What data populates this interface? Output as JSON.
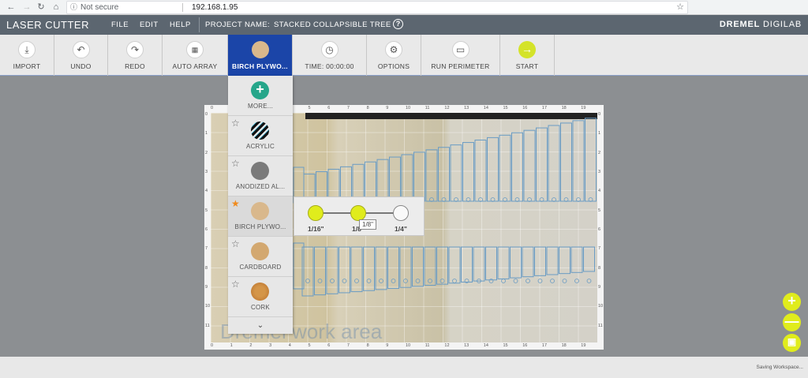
{
  "browser": {
    "back_icon": "arrow-left-icon",
    "security_label": "Not secure",
    "url": "192.168.1.95"
  },
  "menubar": {
    "app_title": "LASER CUTTER",
    "menus": [
      "FILE",
      "EDIT",
      "HELP"
    ],
    "project_label": "PROJECT NAME:",
    "project_name": "STACKED COLLAPSIBLE TREE",
    "help_glyph": "?",
    "brand_bold": "DREMEL",
    "brand_light": " DIGILAB"
  },
  "toolbar": {
    "import": "IMPORT",
    "undo": "UNDO",
    "redo": "REDO",
    "auto_array": "AUTO ARRAY",
    "material": "BIRCH PLYWO...",
    "time": "TIME: 00:00:00",
    "options": "OPTIONS",
    "run_perimeter": "RUN PERIMETER",
    "start": "START"
  },
  "materials": {
    "more": "MORE...",
    "items": [
      {
        "name": "ACRYLIC",
        "favorite": false
      },
      {
        "name": "ANODIZED AL...",
        "favorite": false
      },
      {
        "name": "BIRCH PLYWO...",
        "favorite": true
      },
      {
        "name": "CARDBOARD",
        "favorite": false
      },
      {
        "name": "CORK",
        "favorite": false
      }
    ],
    "colors": {
      "acrylic": "#222222",
      "anodized": "#7a7a7a",
      "birch": "#d9b88c",
      "cardboard": "#d3a870",
      "cork": "#c8803c",
      "favorite_on": "#f08a1c"
    }
  },
  "thickness": {
    "options": [
      "1/16\"",
      "1/8\"",
      "1/4\""
    ],
    "selected": "1/8\"",
    "tooltip": "1/8\""
  },
  "workspace": {
    "watermark": "Dremel work area",
    "ruler_x": [
      "0",
      "1",
      "2",
      "3",
      "4",
      "5",
      "6",
      "7",
      "8",
      "9",
      "10",
      "11",
      "12",
      "13",
      "14",
      "15",
      "16",
      "17",
      "18",
      "19"
    ],
    "ruler_y": [
      "0",
      "1",
      "2",
      "3",
      "4",
      "5",
      "6",
      "7",
      "8",
      "9",
      "10",
      "11"
    ]
  },
  "footer": {
    "status": "Saving Workspace..."
  },
  "accent": {
    "toolbar_active": "#1b45a8",
    "yellow": "#e0ec1c",
    "menubar": "#5c6670"
  }
}
